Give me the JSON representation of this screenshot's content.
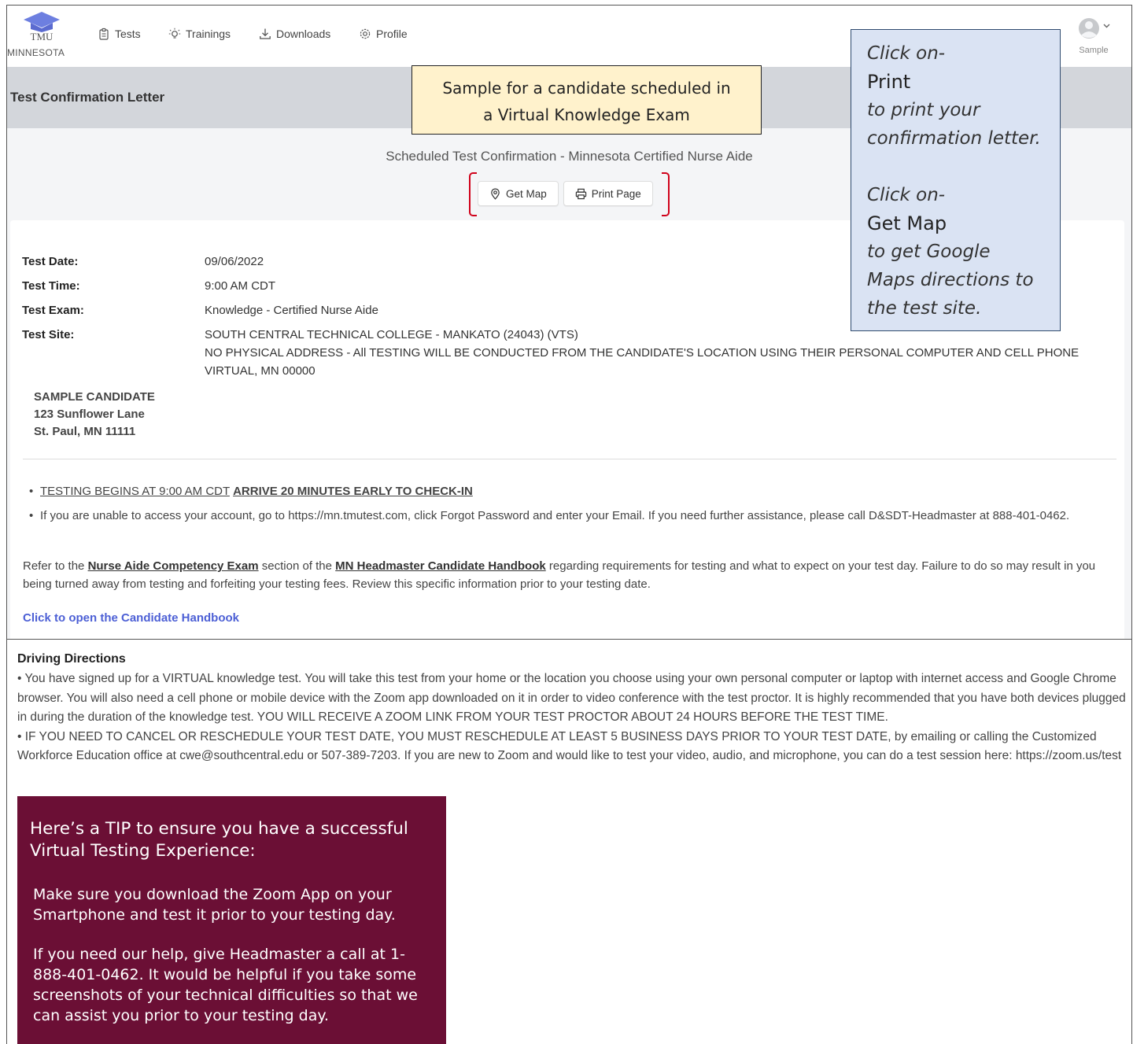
{
  "nav": {
    "logo_text": "TMU",
    "logo_state": "MINNESOTA",
    "items": [
      {
        "label": "Tests",
        "icon": "clipboard-icon"
      },
      {
        "label": "Trainings",
        "icon": "lightbulb-icon"
      },
      {
        "label": "Downloads",
        "icon": "download-icon"
      },
      {
        "label": "Profile",
        "icon": "gear-icon"
      }
    ],
    "user_name": "Sample"
  },
  "page": {
    "title": "Test Confirmation Letter",
    "scheduled_title": "Scheduled Test Confirmation - Minnesota Certified Nurse Aide",
    "get_map_label": "Get Map",
    "print_label": "Print Page"
  },
  "details": [
    {
      "label": "Test Date:",
      "value": "09/06/2022"
    },
    {
      "label": "Test Time:",
      "value": "9:00 AM CDT"
    },
    {
      "label": "Test Exam:",
      "value": "Knowledge - Certified Nurse Aide"
    },
    {
      "label": "Test Site:",
      "lines": [
        "SOUTH CENTRAL TECHNICAL COLLEGE - MANKATO (24043) (VTS)",
        "NO PHYSICAL ADDRESS - All TESTING WILL BE CONDUCTED FROM THE CANDIDATE'S LOCATION USING THEIR PERSONAL COMPUTER AND CELL PHONE",
        "VIRTUAL, MN 00000"
      ]
    }
  ],
  "candidate": {
    "name": "SAMPLE CANDIDATE",
    "street": "123 Sunflower Lane",
    "city": "St. Paul, MN 11111"
  },
  "notes": {
    "testing_begins": "TESTING BEGINS AT 9:00 AM CDT",
    "arrive_early": "ARRIVE 20 MINUTES EARLY TO CHECK-IN",
    "account_note": "If you are unable to access your account, go to https://mn.tmutest.com, click Forgot Password and enter your Email. If you need further assistance, please call D&SDT-Headmaster at 888-401-0462."
  },
  "refer": {
    "prefix": "Refer to the",
    "link1": "Nurse Aide Competency Exam",
    "middle": "section of the",
    "link2": "MN Headmaster Candidate Handbook",
    "suffix": "regarding requirements for testing and what to expect on your test day. Failure to do so may result in you being turned away from testing and forfeiting your testing fees. Review this specific information prior to your testing date."
  },
  "handbook_link": "Click to open the Candidate Handbook",
  "callouts": {
    "yellow_line1": "Sample for a candidate scheduled in",
    "yellow_line2": "a Virtual Knowledge Exam",
    "blue": {
      "click_on_1": "Click on-",
      "print": "Print",
      "print_desc_1": "to print your",
      "print_desc_2": "confirmation letter.",
      "click_on_2": "Click on-",
      "get_map": "Get Map",
      "map_desc_1": "to get Google",
      "map_desc_2": "Maps directions to",
      "map_desc_3": "the test site."
    }
  },
  "driving": {
    "title": "Driving Directions",
    "para1": "• You have signed up for a VIRTUAL knowledge test. You will take this test from your home or the location you choose using your own personal computer or laptop with internet access and Google Chrome browser. You will also need a cell phone or mobile device with the Zoom app downloaded on it in order to video conference with the test proctor. It is highly recommended that you have both devices plugged in during the duration of the knowledge test. YOU WILL RECEIVE A ZOOM LINK FROM YOUR TEST PROCTOR ABOUT 24 HOURS BEFORE THE TEST TIME.",
    "para2": "• IF YOU NEED TO CANCEL OR RESCHEDULE YOUR TEST DATE, YOU MUST RESCHEDULE AT LEAST 5 BUSINESS DAYS PRIOR TO YOUR TEST DATE, by emailing or calling the Customized Workforce Education office at cwe@southcentral.edu or 507-389-7203. If you are new to Zoom and would like to test your video, audio, and microphone, you can do a test session here: https://zoom.us/test"
  },
  "tip": {
    "heading": "Here’s a TIP to ensure you have a successful Virtual Testing Experience:",
    "p1": "Make sure you download the Zoom App on your Smartphone and test it prior to your testing day.",
    "p2": "If you need our help, give Headmaster a call at 1-888-401-0462. It would be helpful if you take some screenshots of your technical difficulties so that we can assist you prior to your testing day."
  },
  "colors": {
    "link_blue": "#4c5fd5",
    "bracket_red": "#d0021b",
    "tip_bg": "#6b0f35",
    "callout_yellow": "#fff2cc",
    "callout_blue": "#dae3f3"
  }
}
